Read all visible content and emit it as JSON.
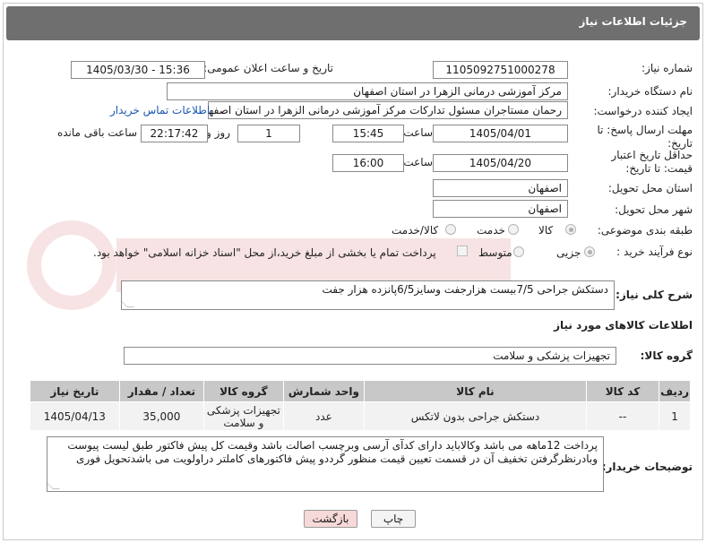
{
  "panel_title": "جزئیات اطلاعات نیاز",
  "fields": {
    "need_number": {
      "label": "شماره نیاز:",
      "value": "1105092751000278"
    },
    "announce_datetime": {
      "label": "تاریخ و ساعت اعلان عمومی:",
      "value": "1405/03/30 - 15:36"
    },
    "buyer_org": {
      "label": "نام دستگاه خریدار:",
      "value": "مرکز آموزشی درمانی الزهرا در استان اصفهان"
    },
    "requester": {
      "label": "ایجاد کننده درخواست:",
      "value": "رحمان مستاجران مسئول تدارکات مرکز آموزشی درمانی الزهرا در استان اصفهان",
      "contact_link": "اطلاعات تماس خریدار"
    },
    "reply_deadline": {
      "label": "مهلت ارسال پاسخ: تا تاریخ:",
      "date": "1405/04/01",
      "time_label": "ساعت",
      "time": "15:45",
      "days": "1",
      "days_label": "روز و",
      "remaining": "22:17:42",
      "remaining_label": "ساعت باقی مانده"
    },
    "price_validity": {
      "label": "حداقل تاریخ اعتبار قیمت: تا تاریخ:",
      "date": "1405/04/20",
      "time_label": "ساعت",
      "time": "16:00"
    },
    "delivery_province": {
      "label": "استان محل تحویل:",
      "value": "اصفهان"
    },
    "delivery_city": {
      "label": "شهر محل تحویل:",
      "value": "اصفهان"
    },
    "category": {
      "label": "طبقه بندی موضوعی:",
      "options": [
        "کالا",
        "خدمت",
        "کالا/خدمت"
      ],
      "selected": "کالا"
    },
    "process_type": {
      "label": "نوع فرآیند خرید :",
      "options": [
        "جزیی",
        "متوسط"
      ],
      "selected": "جزیی",
      "payment_note": "پرداخت تمام یا بخشی از مبلغ خرید،از محل \"اسناد خزانه اسلامی\" خواهد بود."
    }
  },
  "summary": {
    "label": "شرح کلی نیاز:",
    "value": "دستکش جراحی 7/5بیست هزارجفت وسایز6/5پانزده هزار جفت"
  },
  "goods_section_title": "اطلاعات کالاهای مورد نیاز",
  "goods_group": {
    "label": "گروه کالا:",
    "value": "تجهیزات پزشکی و سلامت"
  },
  "table": {
    "headers": [
      "ردیف",
      "کد کالا",
      "نام کالا",
      "واحد شمارش",
      "گروه کالا",
      "تعداد / مقدار",
      "تاریخ نیاز"
    ],
    "rows": [
      [
        "1",
        "--",
        "دستکش جراحی بدون لاتکس",
        "عدد",
        "تجهیزات پزشکی و سلامت",
        "35,000",
        "1405/04/13"
      ]
    ]
  },
  "buyer_notes": {
    "label": "توضیحات خریدار:",
    "value": "پرداخت 12ماهه می باشد وکالاباید دارای کدآی آرسی وبرچسب اصالت باشد وقیمت کل پیش فاکتور طبق لیست پیوست وبادرنظرگرفتن تخفیف آن در قسمت تعیین قیمت منظور گرددو پیش فاکتورهای کاملتر دراولویت می باشدتحویل فوری"
  },
  "buttons": {
    "print": "چاپ",
    "back": "بازگشت"
  },
  "colors": {
    "header_bg": "#6f6f6f",
    "table_head_bg": "#c8c8c8",
    "back_button_bg": "#f7d9d9",
    "link": "#1a55b0"
  }
}
